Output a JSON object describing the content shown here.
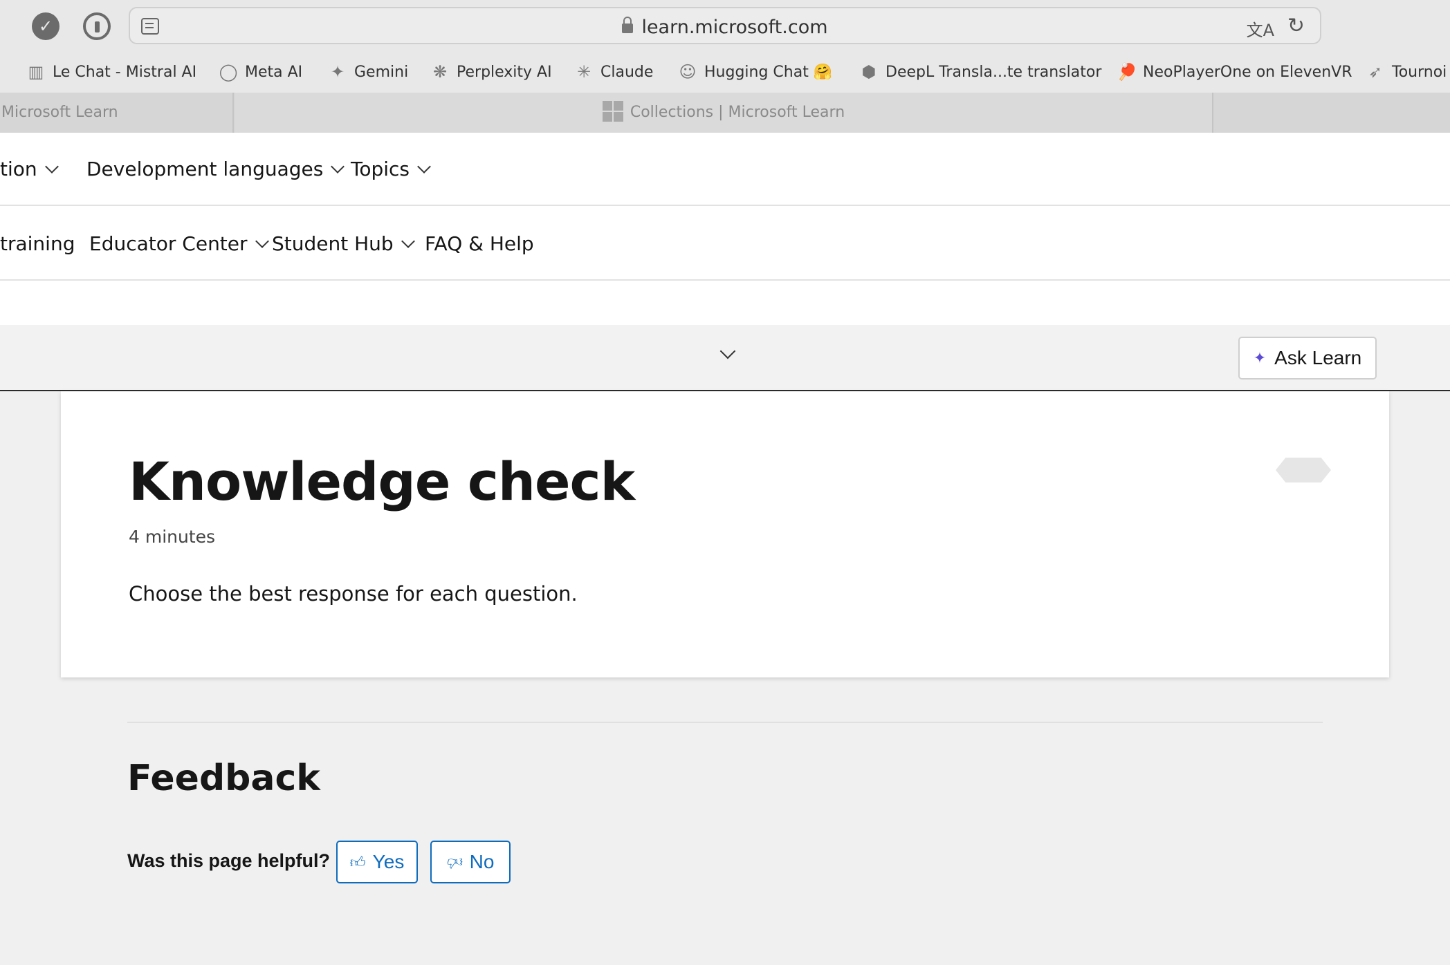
{
  "browser": {
    "url": "learn.microsoft.com",
    "bookmarks": [
      {
        "label": "Le Chat - Mistral AI",
        "icon": "mistral-icon"
      },
      {
        "label": "Meta AI",
        "icon": "meta-ai-icon"
      },
      {
        "label": "Gemini",
        "icon": "gemini-icon"
      },
      {
        "label": "Perplexity AI",
        "icon": "perplexity-icon"
      },
      {
        "label": "Claude",
        "icon": "claude-icon"
      },
      {
        "label": "Hugging Chat 🤗",
        "icon": "hugging-face-icon"
      },
      {
        "label": "DeepL Transla...te translator",
        "icon": "deepl-icon"
      },
      {
        "label": "NeoPlayerOne on ElevenVR",
        "icon": "ping-pong-icon"
      },
      {
        "label": "Tournoi",
        "icon": "tournament-icon"
      }
    ],
    "tabs": [
      {
        "label": "Microsoft Learn"
      },
      {
        "label": "Collections | Microsoft Learn"
      }
    ]
  },
  "nav_primary": [
    {
      "label": "tion"
    },
    {
      "label": "Development languages"
    },
    {
      "label": "Topics"
    }
  ],
  "nav_secondary": [
    {
      "label": "training"
    },
    {
      "label": "Educator Center"
    },
    {
      "label": "Student Hub"
    },
    {
      "label": "FAQ & Help"
    }
  ],
  "subbar": {
    "ask_label": "Ask Learn"
  },
  "content": {
    "title": "Knowledge check",
    "duration": "4 minutes",
    "instruction": "Choose the best response for each question."
  },
  "feedback": {
    "title": "Feedback",
    "question": "Was this page helpful?",
    "yes_label": "Yes",
    "no_label": "No"
  },
  "colors": {
    "accent": "#0f6cbd",
    "spark": "#5b4bd6"
  }
}
